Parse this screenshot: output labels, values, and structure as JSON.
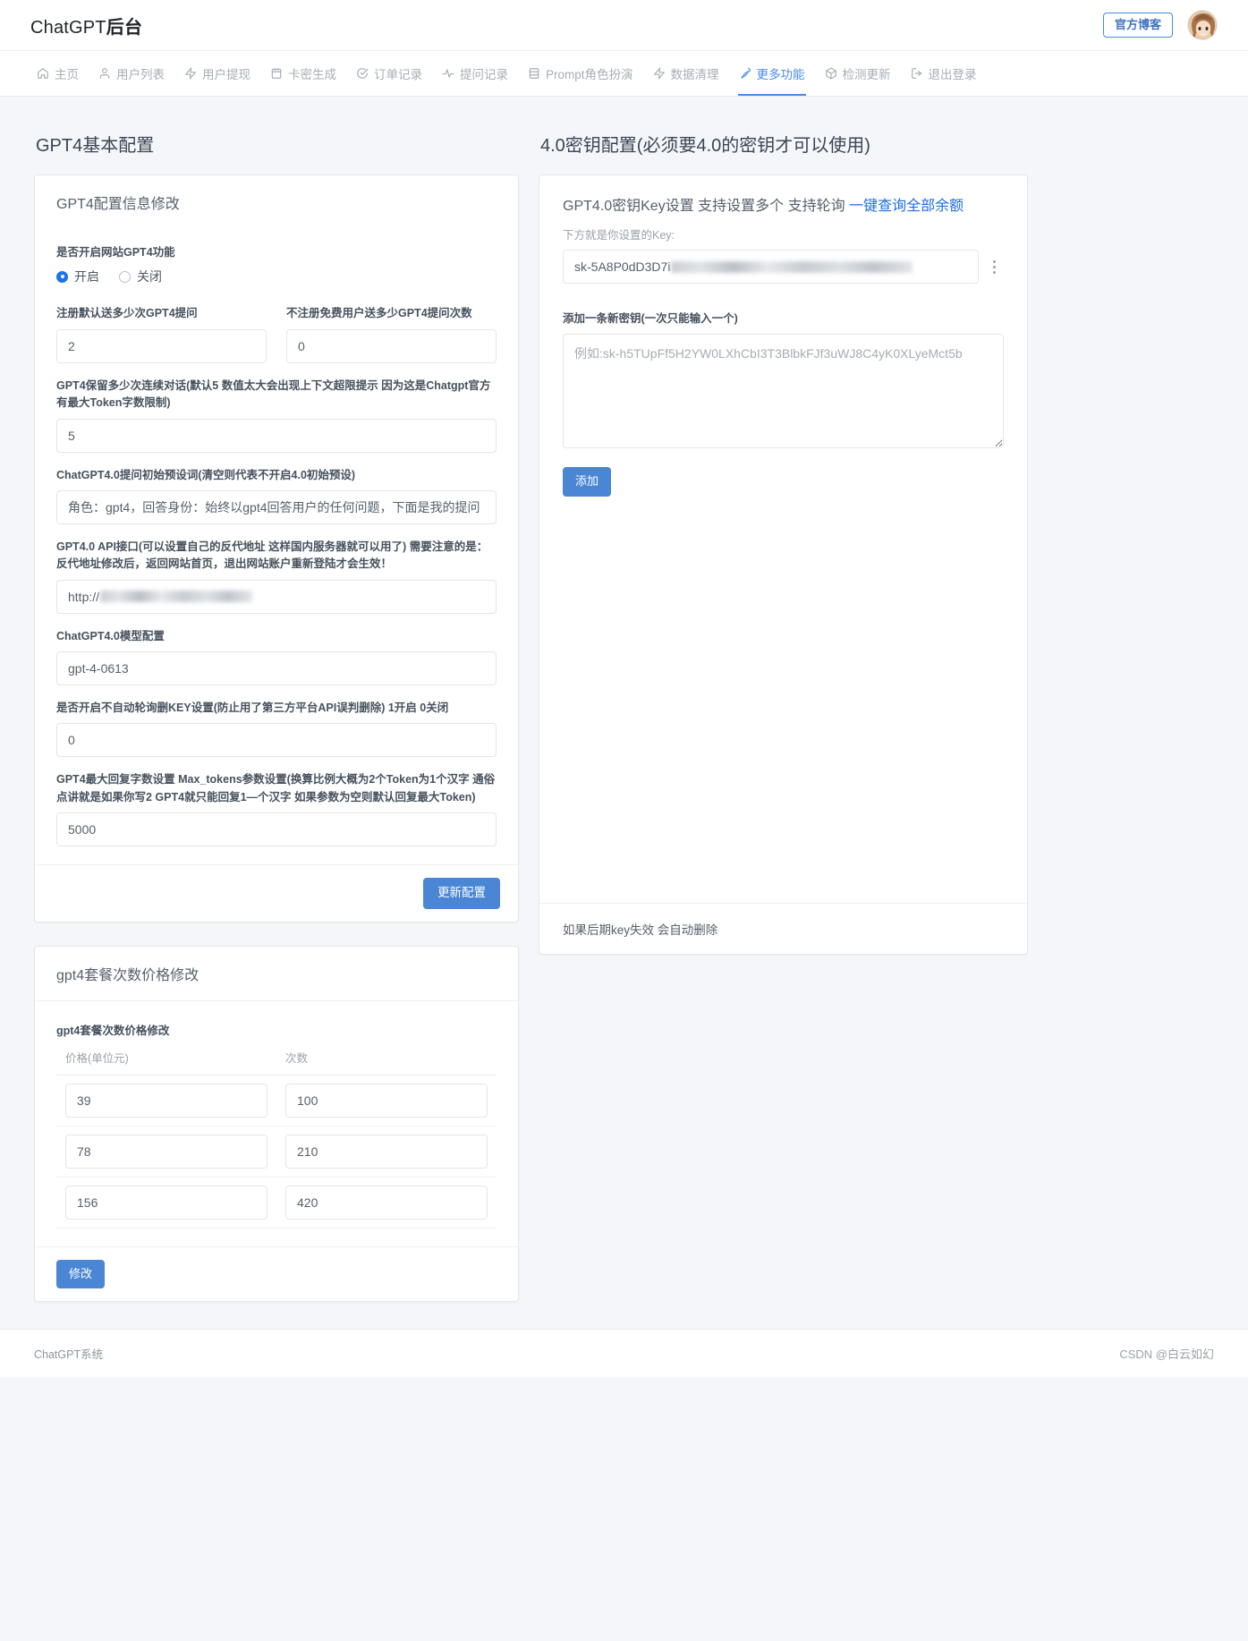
{
  "header": {
    "brand_prefix": "ChatGPT",
    "brand_suffix": "后台",
    "blog_button": "官方博客",
    "avatar_name": "user-avatar"
  },
  "nav": {
    "items": [
      {
        "label": "主页",
        "icon": "home-icon",
        "active": false
      },
      {
        "label": "用户列表",
        "icon": "user-icon",
        "active": false
      },
      {
        "label": "用户提现",
        "icon": "bolt-icon",
        "active": false
      },
      {
        "label": "卡密生成",
        "icon": "calendar-icon",
        "active": false
      },
      {
        "label": "订单记录",
        "icon": "check-circle-icon",
        "active": false
      },
      {
        "label": "提问记录",
        "icon": "activity-icon",
        "active": false
      },
      {
        "label": "Prompt角色扮演",
        "icon": "database-icon",
        "active": false
      },
      {
        "label": "数据清理",
        "icon": "bolt-icon",
        "active": false
      },
      {
        "label": "更多功能",
        "icon": "pen-icon",
        "active": true
      },
      {
        "label": "检测更新",
        "icon": "box-icon",
        "active": false
      },
      {
        "label": "退出登录",
        "icon": "logout-icon",
        "active": false
      }
    ]
  },
  "left": {
    "section_title": "GPT4基本配置",
    "card_title": "GPT4配置信息修改",
    "toggle": {
      "label": "是否开启网站GPT4功能",
      "option_on": "开启",
      "option_off": "关闭",
      "selected": "开启"
    },
    "register_gift": {
      "label": "注册默认送多少次GPT4提问",
      "value": "2"
    },
    "anon_gift": {
      "label": "不注册免费用户送多少GPT4提问次数",
      "value": "0"
    },
    "context_rounds": {
      "label": "GPT4保留多少次连续对话(默认5 数值太大会出现上下文超限提示 因为这是Chatgpt官方有最大Token字数限制)",
      "value": "5"
    },
    "preset_prompt": {
      "label": "ChatGPT4.0提问初始预设词(清空则代表不开启4.0初始预设)",
      "value": "角色：gpt4，回答身份：始终以gpt4回答用户的任何问题，下面是我的提问"
    },
    "api_endpoint": {
      "label": "GPT4.0 API接口(可以设置自己的反代地址 这样国内服务器就可以用了) 需要注意的是：反代地址修改后，返回网站首页，退出网站账户重新登陆才会生效！",
      "value": "http://"
    },
    "model": {
      "label": "ChatGPT4.0模型配置",
      "value": "gpt-4-0613"
    },
    "no_auto_delete_key": {
      "label": "是否开启不自动轮询删KEY设置(防止用了第三方平台API误判删除) 1开启 0关闭",
      "value": "0"
    },
    "max_tokens": {
      "label": "GPT4最大回复字数设置 Max_tokens参数设置(换算比例大概为2个Token为1个汉字 通俗点讲就是如果你写2 GPT4就只能回复1—个汉字 如果参数为空则默认回复最大Token)",
      "value": "5000"
    },
    "update_button": "更新配置"
  },
  "pricing": {
    "card_title": "gpt4套餐次数价格修改",
    "sub_title": "gpt4套餐次数价格修改",
    "columns": [
      "价格(单位元)",
      "次数"
    ],
    "rows": [
      {
        "price": "39",
        "count": "100"
      },
      {
        "price": "78",
        "count": "210"
      },
      {
        "price": "156",
        "count": "420"
      }
    ],
    "submit_button": "修改"
  },
  "right": {
    "section_title": "4.0密钥配置(必须要4.0的密钥才可以使用)",
    "card_title": "GPT4.0密钥Key设置 支持设置多个 支持轮询",
    "card_title_link": "一键查询全部余额",
    "sub_label": "下方就是你设置的Key:",
    "key_value": "sk-5A8P0dD3D7i",
    "add_label": "添加一条新密钥(一次只能输入一个)",
    "add_placeholder": "例如: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",
    "add_value": "",
    "add_button": "添加",
    "footer_note": "如果后期key失效 会自动删除"
  },
  "footer": {
    "left_text": "ChatGPT系统",
    "watermark": "CSDN @白云如幻"
  },
  "colors": {
    "accent": "#4a86d4",
    "link": "#1d6fe0",
    "nav_active": "#4a8bf0",
    "page_bg": "#f4f6f9"
  }
}
